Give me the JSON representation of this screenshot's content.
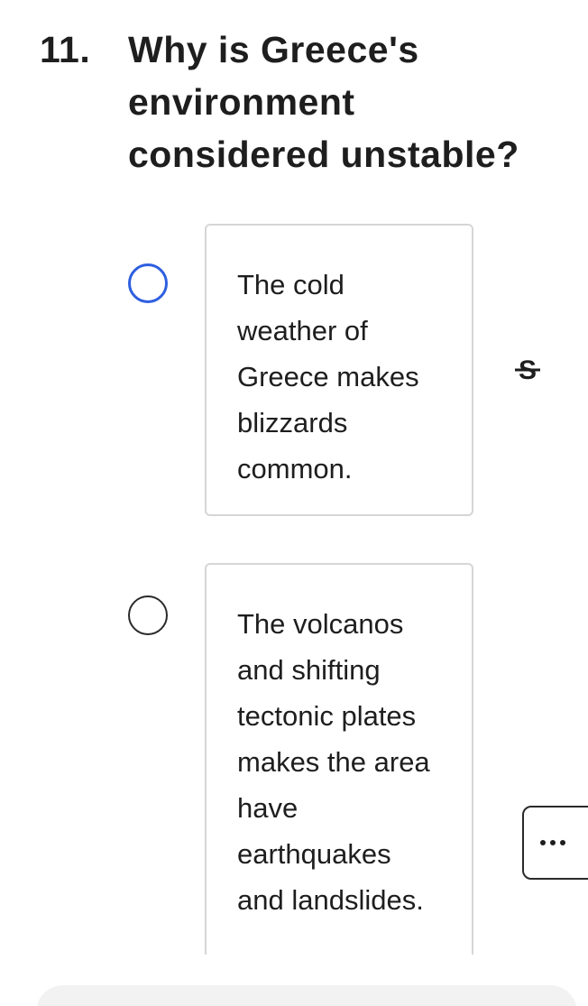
{
  "question": {
    "number": "11.",
    "text": "Why is Greece's environment considered unstable?"
  },
  "options": [
    {
      "text": "The cold weather of Greece makes blizzards common.",
      "state": "highlighted"
    },
    {
      "text": "The volcanos and shifting tectonic plates makes the area have earthquakes and landslides.",
      "state": "default"
    }
  ],
  "tools": {
    "strikethrough_icon": "strikethrough-s-icon",
    "more_icon": "ellipsis-icon"
  },
  "colors": {
    "radio_selected_ring": "#2d5fe0",
    "radio_default_ring": "#2a2a2a",
    "card_border": "#d6d6d6",
    "text": "#1e1e1e"
  }
}
